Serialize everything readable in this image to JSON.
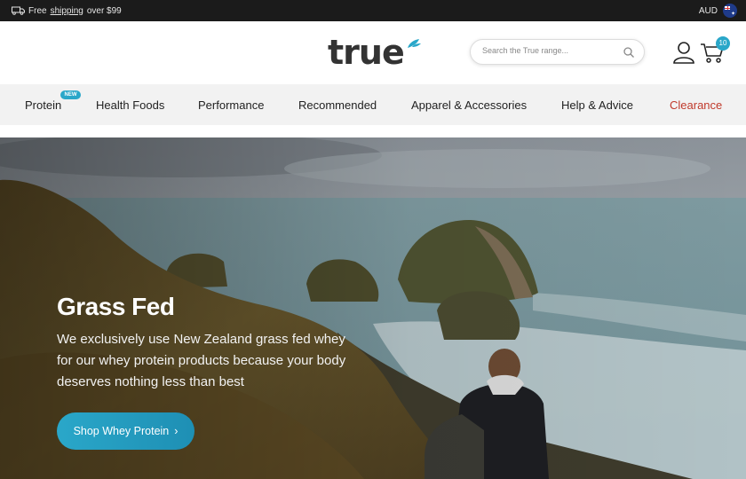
{
  "topbar": {
    "shipping_prefix": "Free",
    "shipping_link": "shipping",
    "shipping_suffix": "over $99",
    "currency": "AUD"
  },
  "header": {
    "logo": "true",
    "search_placeholder": "Search the True range...",
    "cart_count": "10"
  },
  "nav": {
    "items": [
      {
        "label": "Protein",
        "badge": "NEW"
      },
      {
        "label": "Health Foods"
      },
      {
        "label": "Performance"
      },
      {
        "label": "Recommended"
      },
      {
        "label": "Apparel & Accessories"
      },
      {
        "label": "Help & Advice"
      },
      {
        "label": "Clearance"
      }
    ]
  },
  "hero": {
    "title": "Grass Fed",
    "body": "We exclusively use New Zealand grass fed whey for our whey protein products because your body deserves nothing less than best",
    "button": "Shop Whey Protein",
    "button_chevron": "›"
  },
  "colors": {
    "accent": "#2aa7c9",
    "clearance": "#c0392b",
    "topbar": "#1b1b1b"
  }
}
